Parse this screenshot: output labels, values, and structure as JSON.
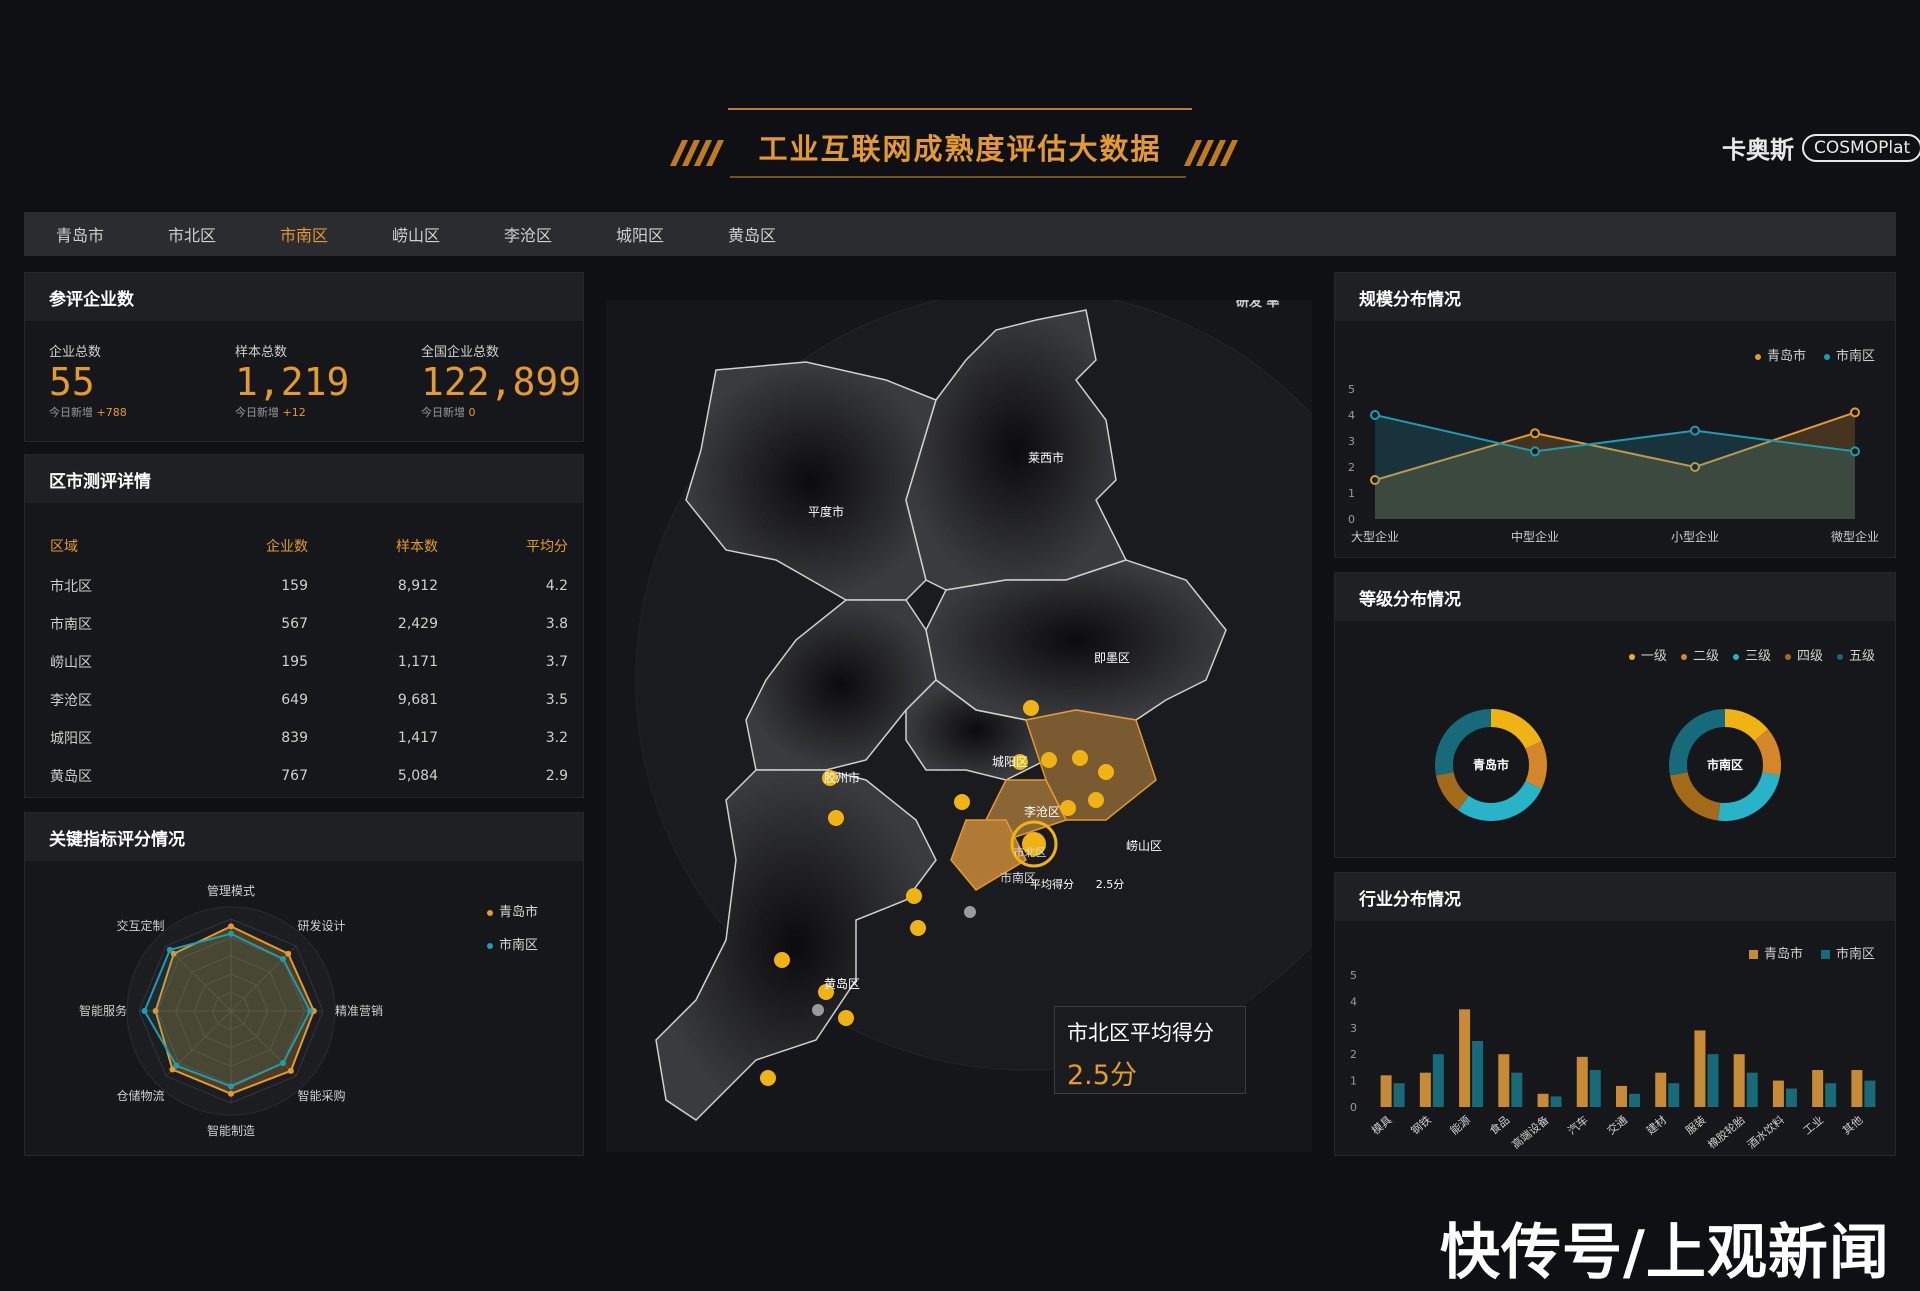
{
  "header": {
    "title": "工业互联网成熟度评估大数据",
    "logo_text": "卡奥斯",
    "logo_brand": "COSMOPlat"
  },
  "nav": {
    "tabs": [
      "青岛市",
      "市北区",
      "市南区",
      "崂山区",
      "李沧区",
      "城阳区",
      "黄岛区"
    ],
    "active": "市南区"
  },
  "participants": {
    "title": "参评企业数",
    "stats": [
      {
        "label": "企业总数",
        "value": "55",
        "note_label": "今日新增",
        "note_value": "+788"
      },
      {
        "label": "样本总数",
        "value": "1,219",
        "note_label": "今日新增",
        "note_value": "+12"
      },
      {
        "label": "全国企业总数",
        "value": "122,899",
        "note_label": "今日新增",
        "note_value": "0"
      }
    ]
  },
  "district_table": {
    "title": "区市测评详情",
    "headers": [
      "区域",
      "企业数",
      "样本数",
      "平均分"
    ],
    "rows": [
      [
        "市北区",
        "159",
        "8,912",
        "4.2"
      ],
      [
        "市南区",
        "567",
        "2,429",
        "3.8"
      ],
      [
        "崂山区",
        "195",
        "1,171",
        "3.7"
      ],
      [
        "李沧区",
        "649",
        "9,681",
        "3.5"
      ],
      [
        "城阳区",
        "839",
        "1,417",
        "3.2"
      ],
      [
        "黄岛区",
        "767",
        "5,084",
        "2.9"
      ]
    ]
  },
  "radar": {
    "title": "关键指标评分情况",
    "axes": [
      "管理模式",
      "研发设计",
      "精准营销",
      "智能采购",
      "智能制造",
      "仓储物流",
      "智能服务",
      "交互定制"
    ],
    "series": [
      {
        "name": "青岛市",
        "color": "#e39a2e",
        "values": [
          4.6,
          4.4,
          4.5,
          4.6,
          4.5,
          4.5,
          4.1,
          4.4
        ]
      },
      {
        "name": "市南区",
        "color": "#1f9cb0",
        "values": [
          4.2,
          4.0,
          4.3,
          4.0,
          4.1,
          4.2,
          4.7,
          4.7
        ]
      }
    ]
  },
  "map": {
    "labels": [
      "平度市",
      "莱西市",
      "即墨区",
      "胶州市",
      "城阳区",
      "李沧区",
      "崂山区",
      "黄岛区",
      "市南区",
      "平均得分",
      "2.5分"
    ],
    "partial_label": "市北区",
    "tooltip_title": "市北区平均得分",
    "tooltip_value": "2.5分",
    "top_fragment": "研发 率"
  },
  "scale_chart": {
    "title": "规模分布情况",
    "chart_data": {
      "type": "line",
      "categories": [
        "大型企业",
        "中型企业",
        "小型企业",
        "微型企业"
      ],
      "ylim": [
        0,
        5
      ],
      "yticks": [
        "0",
        "1",
        "2",
        "3",
        "4",
        "5"
      ],
      "series": [
        {
          "name": "青岛市",
          "color": "#e39a2e",
          "values": [
            1.5,
            3.3,
            2.0,
            4.1
          ]
        },
        {
          "name": "市南区",
          "color": "#1f9cb0",
          "values": [
            4.0,
            2.6,
            3.4,
            2.6
          ]
        }
      ]
    }
  },
  "grade_chart": {
    "title": "等级分布情况",
    "legend": [
      {
        "name": "一级",
        "color": "#f0b314"
      },
      {
        "name": "二级",
        "color": "#d4862a"
      },
      {
        "name": "三级",
        "color": "#29b3c8"
      },
      {
        "name": "四级",
        "color": "#a36a1a"
      },
      {
        "name": "五级",
        "color": "#176a7a"
      }
    ],
    "chart_data": {
      "type": "pie",
      "charts": [
        {
          "name": "青岛市",
          "values": [
            18,
            14,
            28,
            12,
            28
          ]
        },
        {
          "name": "市南区",
          "values": [
            14,
            14,
            24,
            20,
            28
          ]
        }
      ]
    }
  },
  "industry_chart": {
    "title": "行业分布情况",
    "chart_data": {
      "type": "bar",
      "categories": [
        "模具",
        "钢铁",
        "能源",
        "食品",
        "高端设备",
        "汽车",
        "交通",
        "建材",
        "服装",
        "橡胶轮胎",
        "酒水饮料",
        "工业",
        "其他"
      ],
      "ylim": [
        0,
        5
      ],
      "yticks": [
        "0",
        "1",
        "2",
        "3",
        "4",
        "5"
      ],
      "series": [
        {
          "name": "青岛市",
          "color": "#c98a35",
          "values": [
            1.2,
            1.3,
            3.7,
            2.0,
            0.5,
            1.9,
            0.8,
            1.3,
            2.9,
            2.0,
            1.0,
            1.4,
            1.4
          ]
        },
        {
          "name": "市南区",
          "color": "#176a7a",
          "values": [
            0.9,
            2.0,
            2.5,
            1.3,
            0.4,
            1.4,
            0.5,
            0.9,
            2.0,
            1.3,
            0.7,
            0.9,
            1.0
          ]
        }
      ]
    }
  },
  "watermark": "快传号/上观新闻"
}
